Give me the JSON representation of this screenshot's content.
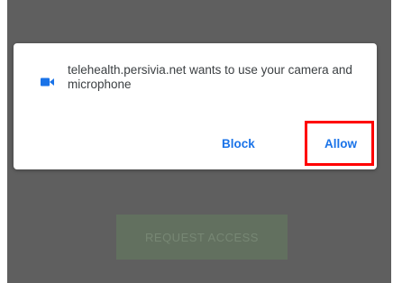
{
  "permission_dialog": {
    "message": "telehealth.persivia.net wants to use your camera and microphone",
    "block_label": "Block",
    "allow_label": "Allow",
    "icon": "video-camera-icon",
    "accent_color": "#1a73e8"
  },
  "background": {
    "request_access_label": "REQUEST ACCESS"
  },
  "annotation": {
    "highlight_color": "#ff0000"
  }
}
